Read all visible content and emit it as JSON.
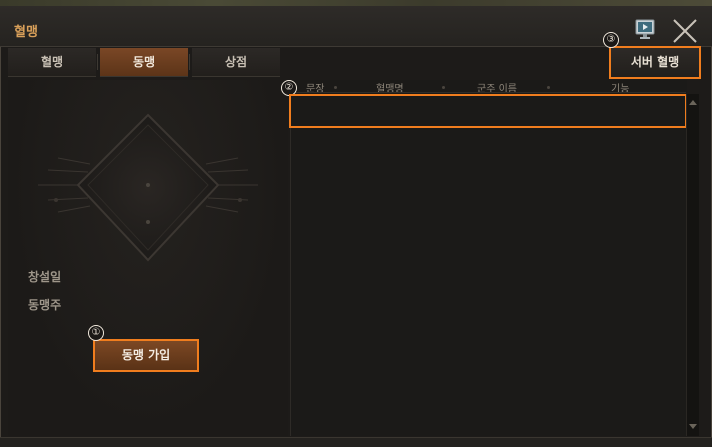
{
  "window": {
    "title": "혈맹"
  },
  "tabs": [
    {
      "label": "혈맹",
      "active": false
    },
    {
      "label": "동맹",
      "active": true
    },
    {
      "label": "상점",
      "active": false
    }
  ],
  "header_buttons": {
    "server_label": "서버 혈맹",
    "monitor_icon": "monitor-icon",
    "close_icon": "close-icon"
  },
  "left_panel": {
    "founded_label": "창설일",
    "leader_label": "동맹주",
    "join_button": "동맹 가입"
  },
  "table": {
    "columns": [
      "문장",
      "혈맹명",
      "군주 이름",
      "기능"
    ]
  },
  "markers": [
    "①",
    "②",
    "③"
  ],
  "colors": {
    "accent_title": "#d9a05a",
    "highlight_border": "#f07d1e",
    "active_tab": "#7a4726"
  }
}
